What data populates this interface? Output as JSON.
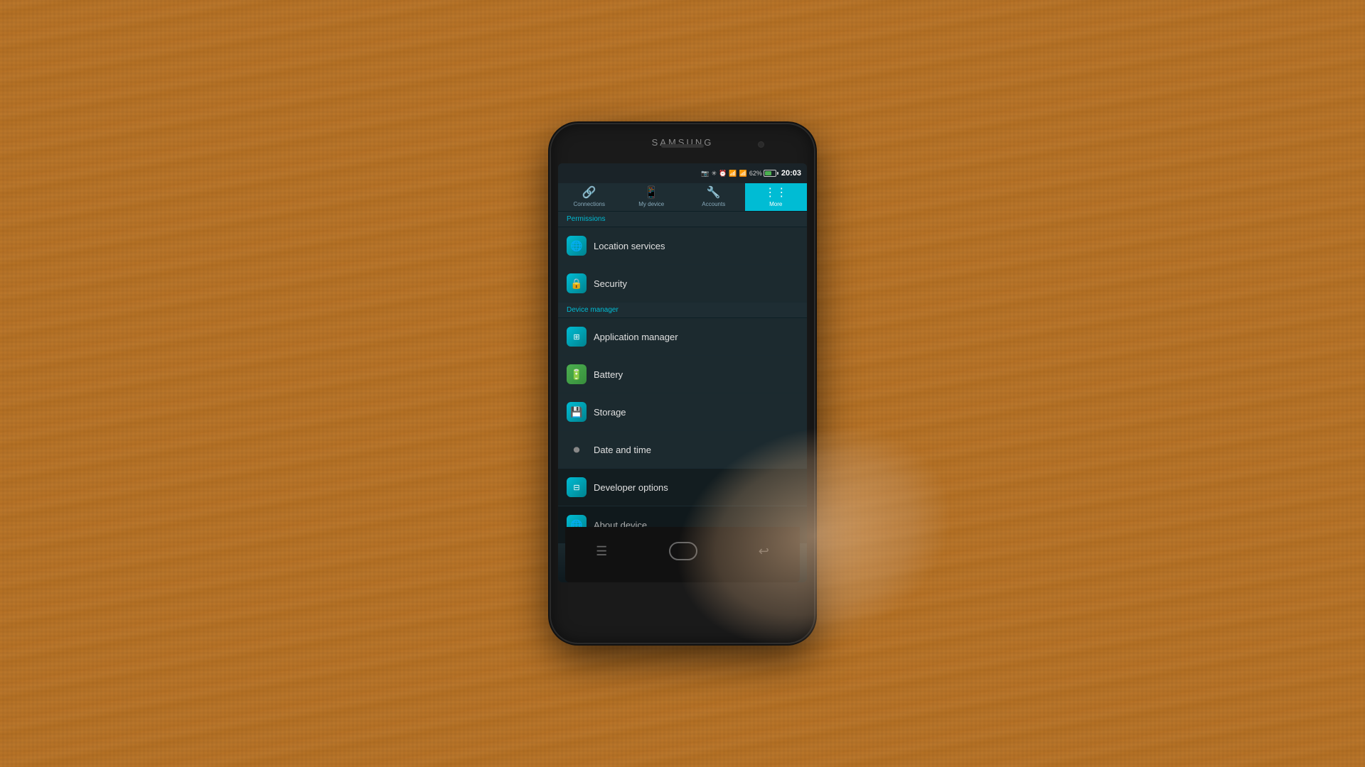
{
  "phone": {
    "brand": "SAMSUNG",
    "time": "20:03",
    "battery_percent": "62%",
    "screen": {
      "tabs": [
        {
          "id": "connections",
          "label": "Connections",
          "icon": "⊞",
          "active": false
        },
        {
          "id": "my-device",
          "label": "My device",
          "icon": "📱",
          "active": false
        },
        {
          "id": "accounts",
          "label": "Accounts",
          "icon": "🔧",
          "active": false
        },
        {
          "id": "more",
          "label": "More",
          "icon": "⋮⋮",
          "active": true
        }
      ],
      "sections": [
        {
          "header": "Permissions",
          "items": [
            {
              "id": "location-services",
              "label": "Location services",
              "icon": "🌐",
              "icon_style": "teal"
            },
            {
              "id": "security",
              "label": "Security",
              "icon": "🔒",
              "icon_style": "teal"
            }
          ]
        },
        {
          "header": "Device manager",
          "items": [
            {
              "id": "application-manager",
              "label": "Application manager",
              "icon": "⊞",
              "icon_style": "teal"
            },
            {
              "id": "battery",
              "label": "Battery",
              "icon": "🔋",
              "icon_style": "green"
            },
            {
              "id": "storage",
              "label": "Storage",
              "icon": "💾",
              "icon_style": "teal"
            },
            {
              "id": "date-and-time",
              "label": "Date and time",
              "icon": "⏰",
              "icon_style": "grey"
            },
            {
              "id": "developer-options",
              "label": "Developer options",
              "icon": "⊟",
              "icon_style": "teal"
            },
            {
              "id": "about-device",
              "label": "About device",
              "icon": "🌐",
              "icon_style": "teal"
            }
          ]
        }
      ],
      "nav": {
        "menu_icon": "☰",
        "home_label": "home",
        "back_icon": "↩"
      }
    }
  }
}
